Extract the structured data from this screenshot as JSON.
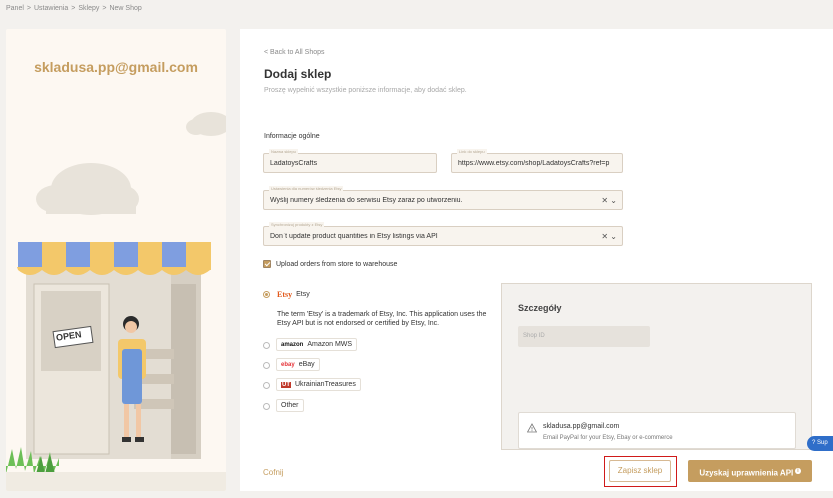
{
  "breadcrumb": [
    "Panel",
    "Ustawienia",
    "Sklepy",
    "New Shop"
  ],
  "left": {
    "email": "skladusa.pp@gmail.com",
    "sign_text": "OPEN"
  },
  "form": {
    "back": "< Back to All Shops",
    "title": "Dodaj sklep",
    "subtitle": "Proszę wypełnić wszystkie poniższe informacje, aby dodać sklep.",
    "section": "Informacje ogólne",
    "shop_name_label": "Nazwa sklepu",
    "shop_name_value": "LadatoysCrafts",
    "shop_link_label": "Link do sklepu",
    "shop_link_value": "https://www.etsy.com/shop/LadatoysCrafts?ref=p",
    "tracking_label": "Ustawienia dla numerów śledzenia Etsy",
    "tracking_value": "Wyślij numery śledzenia do serwisu Etsy zaraz po utworzeniu.",
    "sync_label": "Synchronizuj produkty z Etsy",
    "sync_value": "Don`t update product quantities in Etsy listings via API",
    "upload_orders": "Upload orders from store to warehouse",
    "platforms": [
      {
        "logo": "Etsy",
        "label": "Etsy",
        "selected": true
      },
      {
        "logo": "amazon",
        "label": "Amazon MWS",
        "selected": false
      },
      {
        "logo": "ebay",
        "label": "eBay",
        "selected": false
      },
      {
        "logo": "UT",
        "label": "UkrainianTreasures",
        "selected": false
      },
      {
        "logo": "",
        "label": "Other",
        "selected": false
      }
    ],
    "etsy_note": "The term 'Etsy' is a trademark of Etsy, Inc. This application uses the Etsy API but is not endorsed or certified by Etsy, Inc.",
    "details_title": "Szczegóły",
    "shop_id_placeholder": "Shop ID",
    "paypal_email": "skladusa.pp@gmail.com",
    "paypal_hint": "Email PayPal for your Etsy, Ebay or e-commerce",
    "back_button": "Cofnij",
    "save_button": "Zapisz sklep",
    "api_button": "Uzyskaj uprawnienia API",
    "help_button": "Sup"
  },
  "colors": {
    "accent": "#c59d5f",
    "highlight": "#d01a1a",
    "help": "#2f6ec9"
  }
}
